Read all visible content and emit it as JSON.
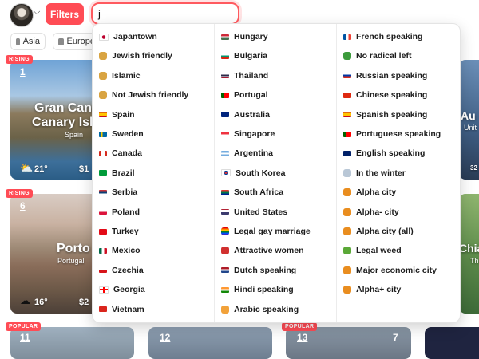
{
  "topbar": {
    "filters_label": "Filters",
    "search_value": "j",
    "accent": "#ff4c55"
  },
  "chips": [
    {
      "label": "Asia"
    },
    {
      "label": "Europe"
    }
  ],
  "cards": [
    {
      "badge": "RISING",
      "rank": "1",
      "city": "Gran Canaria",
      "city_shown": "Gran Cana",
      "city_line2": "Canary Isla",
      "country": "Spain",
      "temp": "21°",
      "price": "$1"
    },
    {
      "badge": "RISING",
      "rank": "6",
      "city_shown": "Porto",
      "country": "Portugal",
      "temp": "16°",
      "price": "$2"
    },
    {
      "badge": "POPULAR",
      "rank": "11"
    },
    {
      "rank": "12"
    },
    {
      "badge": "POPULAR",
      "rank": "13",
      "extra": "7"
    },
    {
      "city_shown": "Au",
      "country": "Unit",
      "temp": "32"
    },
    {
      "city_shown": "Chia",
      "country": "Th"
    }
  ],
  "dropdown": {
    "columns": [
      [
        {
          "label": "Japantown",
          "icon": "flag-japan"
        },
        {
          "label": "Jewish friendly",
          "icon": "synagogue-icon"
        },
        {
          "label": "Islamic",
          "icon": "mosque-icon"
        },
        {
          "label": "Not Jewish friendly",
          "icon": "synagogue-icon"
        },
        {
          "label": "Spain",
          "icon": "flag-spain"
        },
        {
          "label": "Sweden",
          "icon": "flag-sweden"
        },
        {
          "label": "Canada",
          "icon": "flag-canada"
        },
        {
          "label": "Brazil",
          "icon": "flag-brazil"
        },
        {
          "label": "Serbia",
          "icon": "flag-serbia"
        },
        {
          "label": "Poland",
          "icon": "flag-poland"
        },
        {
          "label": "Turkey",
          "icon": "flag-turkey"
        },
        {
          "label": "Mexico",
          "icon": "flag-mexico"
        },
        {
          "label": "Czechia",
          "icon": "flag-czechia"
        },
        {
          "label": "Georgia",
          "icon": "flag-georgia"
        },
        {
          "label": "Vietnam",
          "icon": "flag-vietnam"
        }
      ],
      [
        {
          "label": "Hungary",
          "icon": "flag-hungary"
        },
        {
          "label": "Bulgaria",
          "icon": "flag-bulgaria"
        },
        {
          "label": "Thailand",
          "icon": "flag-thailand"
        },
        {
          "label": "Portugal",
          "icon": "flag-portugal"
        },
        {
          "label": "Australia",
          "icon": "flag-australia"
        },
        {
          "label": "Singapore",
          "icon": "flag-singapore"
        },
        {
          "label": "Argentina",
          "icon": "flag-argentina"
        },
        {
          "label": "South Korea",
          "icon": "flag-south-korea"
        },
        {
          "label": "South Africa",
          "icon": "flag-south-africa"
        },
        {
          "label": "United States",
          "icon": "flag-united-states"
        },
        {
          "label": "Legal gay marriage",
          "icon": "rainbow-icon"
        },
        {
          "label": "Attractive women",
          "icon": "women-icon"
        },
        {
          "label": "Dutch speaking",
          "icon": "flag-netherlands"
        },
        {
          "label": "Hindi speaking",
          "icon": "flag-india"
        },
        {
          "label": "Arabic speaking",
          "icon": "arabic-icon"
        }
      ],
      [
        {
          "label": "French speaking",
          "icon": "flag-france"
        },
        {
          "label": "No radical left",
          "icon": "person-icon"
        },
        {
          "label": "Russian speaking",
          "icon": "flag-russia"
        },
        {
          "label": "Chinese speaking",
          "icon": "flag-china"
        },
        {
          "label": "Spanish speaking",
          "icon": "flag-spain"
        },
        {
          "label": "Portuguese speaking",
          "icon": "flag-portugal"
        },
        {
          "label": "English speaking",
          "icon": "flag-uk"
        },
        {
          "label": "In the winter",
          "icon": "snowman-icon"
        },
        {
          "label": "Alpha city",
          "icon": "city-icon"
        },
        {
          "label": "Alpha- city",
          "icon": "city-icon"
        },
        {
          "label": "Alpha city (all)",
          "icon": "city-icon"
        },
        {
          "label": "Legal weed",
          "icon": "leaf-icon"
        },
        {
          "label": "Major economic city",
          "icon": "city-icon"
        },
        {
          "label": "Alpha+ city",
          "icon": "city-icon"
        }
      ]
    ],
    "icon_colors": {
      "flag-japan": "linear-gradient(#fff,#fff)",
      "synagogue-icon": "#d9a441",
      "mosque-icon": "#d9a441",
      "flag-spain": "linear-gradient(#c60b1e 0 25%,#ffc400 25% 75%,#c60b1e 75%)",
      "flag-sweden": "linear-gradient(90deg,#006aa7 0 30%,#fecc00 30% 45%,#006aa7 45%)",
      "flag-canada": "linear-gradient(90deg,#d52b1e 0 28%,#fff 28% 72%,#d52b1e 72%)",
      "flag-brazil": "#009b3a",
      "flag-serbia": "linear-gradient(#c6363c 0 33%,#0c4076 33% 66%,#fff 66%)",
      "flag-poland": "linear-gradient(#fff 0 50%,#dc143c 50%)",
      "flag-turkey": "#e30a17",
      "flag-mexico": "linear-gradient(90deg,#006847 0 33%,#fff 33% 66%,#ce1126 66%)",
      "flag-czechia": "linear-gradient(#fff 0 50%,#d7141a 50%)",
      "flag-georgia": "linear-gradient(#fff,#fff)",
      "flag-vietnam": "#da251d",
      "flag-hungary": "linear-gradient(#ce2939 0 33%,#fff 33% 66%,#477050 66%)",
      "flag-bulgaria": "linear-gradient(#fff 0 33%,#00966e 33% 66%,#d62612 66%)",
      "flag-thailand": "linear-gradient(#a51931 0 17%,#fff 17% 33%,#2d2a4a 33% 67%,#fff 67% 83%,#a51931 83%)",
      "flag-portugal": "linear-gradient(90deg,#006600 0 40%,#ff0000 40%)",
      "flag-australia": "#00247d",
      "flag-singapore": "linear-gradient(#ef3340 0 50%,#fff 50%)",
      "flag-argentina": "linear-gradient(#74acdf 0 33%,#fff 33% 66%,#74acdf 66%)",
      "flag-south-korea": "linear-gradient(#fff,#fff)",
      "flag-south-africa": "linear-gradient(#de3831 0 33%,#007a4d 33% 66%,#002395 66%)",
      "flag-united-states": "linear-gradient(#b22234 0 15%,#fff 15% 30%,#b22234 30% 45%,#fff 45% 60%,#3c3b6e 60%)",
      "rainbow-icon": "linear-gradient(#e40303 0 17%,#ff8c00 17% 33%,#ffed00 33% 50%,#008026 50% 67%,#004dff 67% 83%,#750787 83%)",
      "women-icon": "#d1302f",
      "flag-netherlands": "linear-gradient(#ae1c28 0 33%,#fff 33% 66%,#21468b 66%)",
      "flag-india": "linear-gradient(#ff9933 0 33%,#fff 33% 66%,#138808 66%)",
      "arabic-icon": "#f2a23a",
      "flag-france": "linear-gradient(90deg,#0055a4 0 33%,#fff 33% 66%,#ef4135 66%)",
      "person-icon": "#3c9b3c",
      "flag-russia": "linear-gradient(#fff 0 33%,#0039a6 33% 66%,#d52b1e 66%)",
      "flag-china": "#de2910",
      "flag-uk": "#012169",
      "snowman-icon": "#b9c7d6",
      "city-icon": "#e98d1f",
      "leaf-icon": "#5aa837"
    }
  }
}
